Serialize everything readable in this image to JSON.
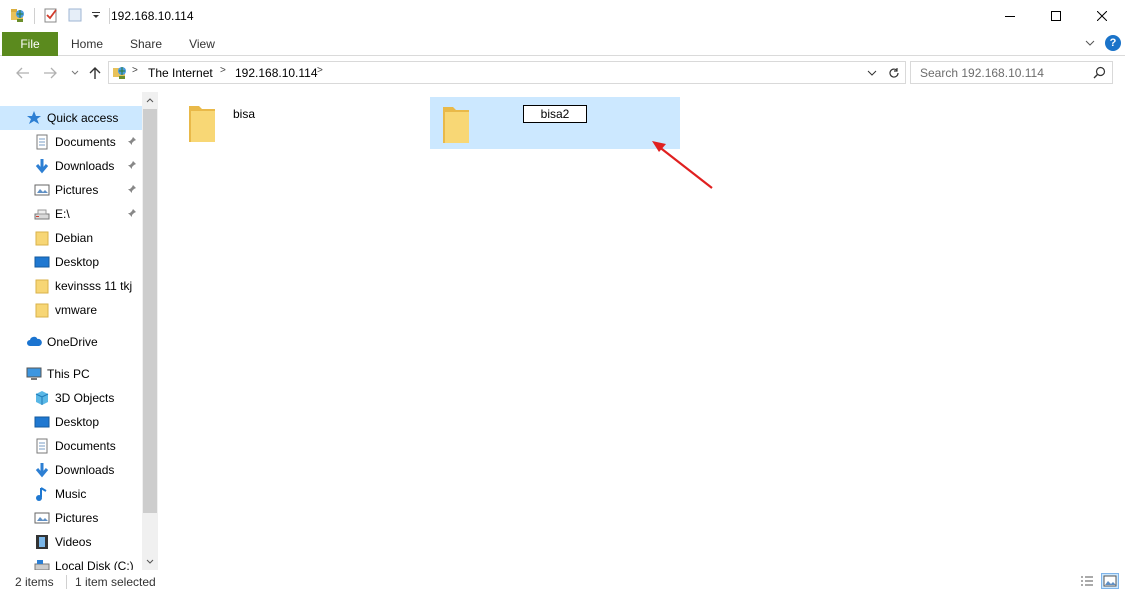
{
  "window": {
    "title": "192.168.10.114"
  },
  "ribbon": {
    "tabs": [
      "File",
      "Home",
      "Share",
      "View"
    ]
  },
  "address": {
    "crumbs": [
      "The Internet",
      "192.168.10.114"
    ],
    "search_placeholder": "Search 192.168.10.114"
  },
  "sidebar": {
    "quick_access": "Quick access",
    "pinned": [
      "Documents",
      "Downloads",
      "Pictures",
      "E:\\"
    ],
    "recent": [
      "Debian",
      "Desktop",
      "kevinsss 11 tkj",
      "vmware"
    ],
    "onedrive": "OneDrive",
    "this_pc": "This PC",
    "pc_items": [
      "3D Objects",
      "Desktop",
      "Documents",
      "Downloads",
      "Music",
      "Pictures",
      "Videos",
      "Local Disk (C:)"
    ]
  },
  "files": [
    {
      "name": "bisa",
      "selected": false
    },
    {
      "name": "bisa2",
      "selected": true,
      "renaming": true
    }
  ],
  "status": {
    "count": "2 items",
    "selected": "1 item selected"
  },
  "colors": {
    "file_tab": "#5b8a1e",
    "selection": "#cce8ff",
    "annotation_arrow": "#e02020"
  }
}
